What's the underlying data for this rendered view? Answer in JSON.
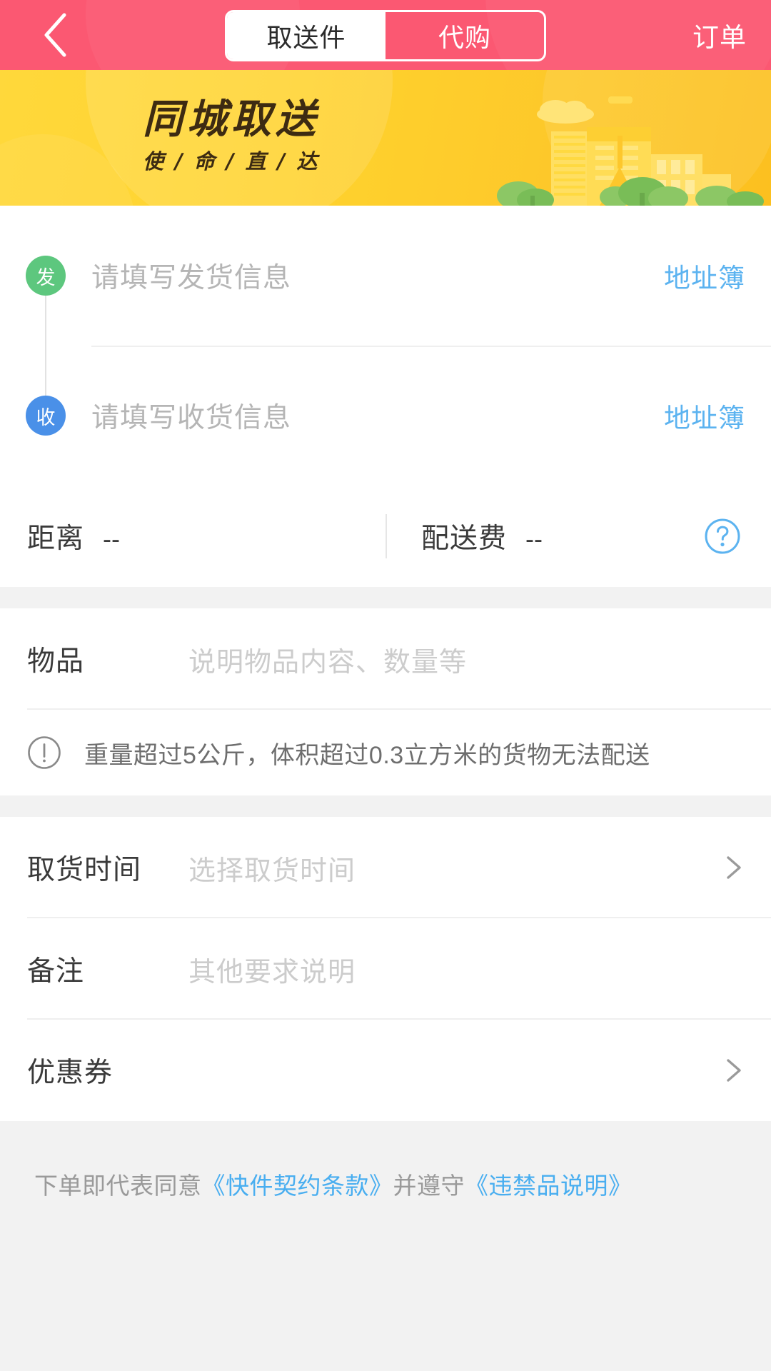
{
  "header": {
    "back_icon": "chevron-left-icon",
    "tabs": [
      {
        "label": "取送件",
        "active": true
      },
      {
        "label": "代购",
        "active": false
      }
    ],
    "orders_label": "订单",
    "background_color": "#fb5872"
  },
  "banner": {
    "title": "同城取送",
    "subtitle": "使 / 命 / 直 / 达",
    "background_color": "#ffd32e",
    "illustration": "city-skyline-with-trees"
  },
  "addresses": {
    "sender": {
      "badge": "发",
      "badge_color": "#5dc77e",
      "placeholder": "请填写发货信息",
      "addressbook_label": "地址簿"
    },
    "receiver": {
      "badge": "收",
      "badge_color": "#4a90e8",
      "placeholder": "请填写收货信息",
      "addressbook_label": "地址簿"
    }
  },
  "meta": {
    "distance_label": "距离",
    "distance_value": "--",
    "fee_label": "配送费",
    "fee_value": "--",
    "help_icon": "question-circle-icon",
    "help_icon_color": "#5cb3f0"
  },
  "goods": {
    "label": "物品",
    "placeholder": "说明物品内容、数量等"
  },
  "notice": {
    "icon": "exclamation-circle-icon",
    "text": "重量超过5公斤，体积超过0.3立方米的货物无法配送"
  },
  "pickup_time": {
    "label": "取货时间",
    "placeholder": "选择取货时间",
    "chevron": "chevron-right-icon"
  },
  "remark": {
    "label": "备注",
    "placeholder": "其他要求说明"
  },
  "coupon": {
    "label": "优惠券",
    "value": "",
    "chevron": "chevron-right-icon"
  },
  "footer": {
    "prefix": "下单即代表同意",
    "link1": "《快件契约条款》",
    "middle": "并遵守",
    "link2": "《违禁品说明》",
    "link_color": "#49aef0"
  }
}
